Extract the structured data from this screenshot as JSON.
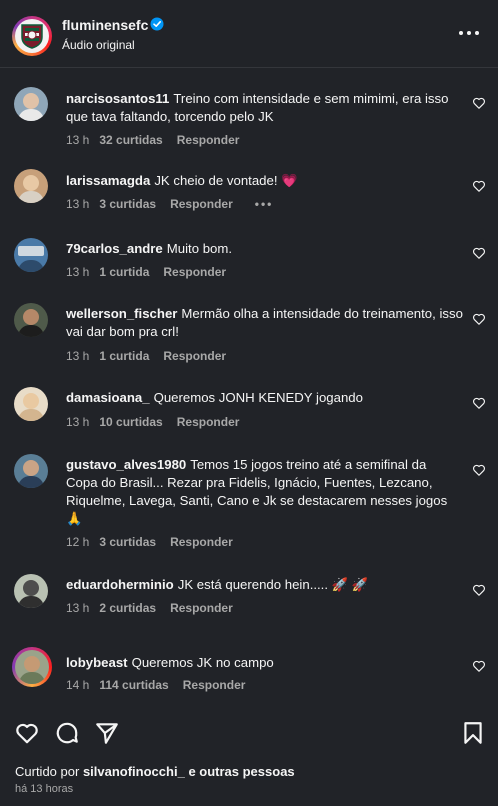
{
  "post": {
    "username": "fluminensefc",
    "audio": "Áudio original"
  },
  "comments": [
    {
      "user": "narcisosantos11",
      "text": "Treino com intensidade e sem mimimi, era isso que tava faltando, torcendo pelo JK",
      "time": "13 h",
      "likes": "32 curtidas",
      "reply": "Responder"
    },
    {
      "user": "larissamagda",
      "text": "JK cheio de vontade!",
      "emoji": "💗",
      "time": "13 h",
      "likes": "3 curtidas",
      "reply": "Responder",
      "more": "•••"
    },
    {
      "user": "79carlos_andre",
      "text": "Muito bom.",
      "time": "13 h",
      "likes": "1 curtida",
      "reply": "Responder"
    },
    {
      "user": "wellerson_fischer",
      "text": "Mermão olha a intensidade do treinamento, isso vai dar bom pra crl!",
      "time": "13 h",
      "likes": "1 curtida",
      "reply": "Responder"
    },
    {
      "user": "damasioana_",
      "text": "Queremos JONH KENEDY jogando",
      "time": "13 h",
      "likes": "10 curtidas",
      "reply": "Responder"
    },
    {
      "user": "gustavo_alves1980",
      "text": "Temos 15 jogos treino até a semifinal da Copa do Brasil... Rezar pra Fidelis, Ignácio, Fuentes, Lezcano, Riquelme, Lavega, Santi, Cano e Jk se destacarem nesses jogos",
      "emoji": "🙏",
      "time": "12 h",
      "likes": "3 curtidas",
      "reply": "Responder"
    },
    {
      "user": "eduardoherminio",
      "text": "JK está querendo hein.....",
      "emoji": "🚀 🚀",
      "time": "13 h",
      "likes": "2 curtidas",
      "reply": "Responder"
    },
    {
      "user": "lobybeast",
      "text": "Queremos JK no campo",
      "time": "14 h",
      "likes": "114 curtidas",
      "reply": "Responder"
    }
  ],
  "footer": {
    "liked_prefix": "Curtido por",
    "liked_user": "silvanofinocchi_",
    "liked_suffix": "e outras pessoas",
    "time": "há 13 horas"
  },
  "icons": {
    "verified": "verified-badge-icon",
    "more": "more-options-icon",
    "heart": "heart-icon",
    "comment": "comment-icon",
    "share": "share-icon",
    "save": "bookmark-icon"
  },
  "colors": {
    "background": "#212328",
    "text": "#f5f5f5",
    "muted": "#a8a8a8",
    "verified": "#0095f6"
  }
}
